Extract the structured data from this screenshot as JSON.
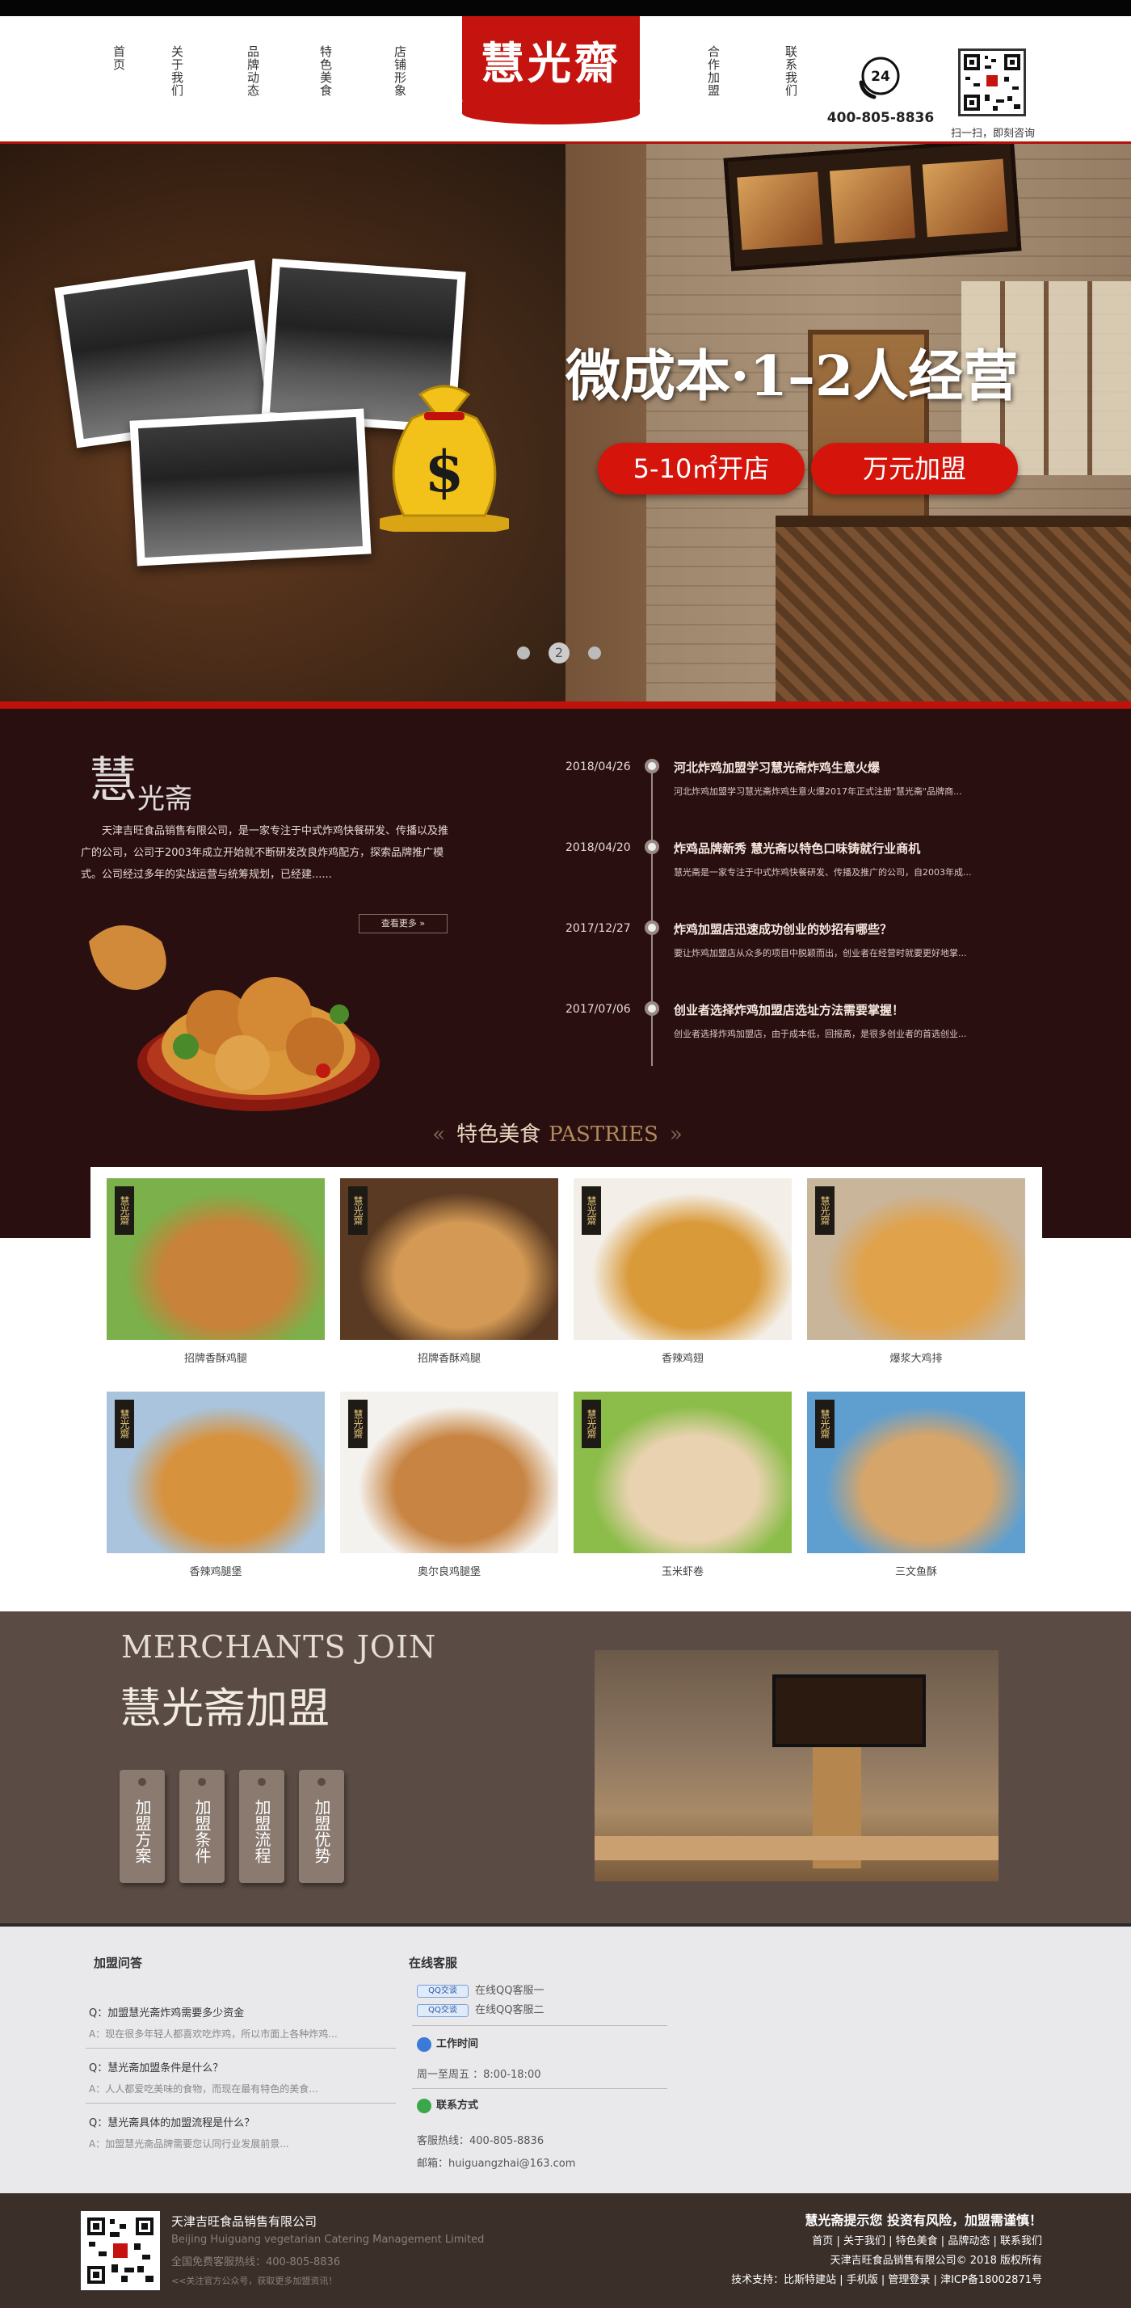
{
  "header": {
    "nav_left": [
      "首页",
      "关于我们",
      "品牌动态",
      "特色美食",
      "店铺形象"
    ],
    "nav_right": [
      "合作加盟",
      "联系我们"
    ],
    "logo": "慧光齋",
    "phone_icon_text": "24",
    "phone": "400-805-8836",
    "qr_caption": "扫一扫，即刻咨询"
  },
  "banner": {
    "title": "微成本·1–2人经营",
    "pill_left": "5-10㎡开店",
    "pill_right": "万元加盟",
    "carousel_dots": [
      "",
      "2",
      ""
    ],
    "money_symbol": "$"
  },
  "about": {
    "logo_big": "慧",
    "logo_small": "光",
    "logo_big2": "斋",
    "text": "天津吉旺食品销售有限公司，是一家专注于中式炸鸡快餐研发、传播以及推广的公司，公司于2003年成立开始就不断研发改良炸鸡配方，探索品牌推广模式。公司经过多年的实战运营与统筹规划，已经建......",
    "more": "查看更多",
    "news": [
      {
        "date": "2018/04/26",
        "title": "河北炸鸡加盟学习慧光斋炸鸡生意火爆",
        "desc": "河北炸鸡加盟学习慧光斋炸鸡生意火爆2017年正式注册\"慧光斋\"品牌商..."
      },
      {
        "date": "2018/04/20",
        "title": "炸鸡品牌新秀 慧光斋以特色口味铸就行业商机",
        "desc": "慧光斋是一家专注于中式炸鸡快餐研发、传播及推广的公司，自2003年成..."
      },
      {
        "date": "2017/12/27",
        "title": "炸鸡加盟店迅速成功创业的妙招有哪些？",
        "desc": "要让炸鸡加盟店从众多的项目中脱颖而出，创业者在经营时就要更好地掌..."
      },
      {
        "date": "2017/07/06",
        "title": "创业者选择炸鸡加盟店选址方法需要掌握！",
        "desc": "创业者选择炸鸡加盟店，由于成本低，回报高，是很多创业者的首选创业..."
      }
    ]
  },
  "pastries": {
    "title_cn": "特色美食",
    "title_en": "PASTRIES",
    "badge": "慧光齋",
    "items": [
      {
        "name": "招牌香酥鸡腿",
        "colors": [
          "#7bb04a",
          "#c8823a"
        ]
      },
      {
        "name": "招牌香酥鸡腿",
        "colors": [
          "#5a3a22",
          "#d49a55"
        ]
      },
      {
        "name": "香辣鸡翅",
        "colors": [
          "#f3efe8",
          "#d99a3a"
        ]
      },
      {
        "name": "爆浆大鸡排",
        "colors": [
          "#c9b59a",
          "#e0a24a"
        ]
      },
      {
        "name": "香辣鸡腿堡",
        "colors": [
          "#a9c4dc",
          "#d7923e"
        ]
      },
      {
        "name": "奥尔良鸡腿堡",
        "colors": [
          "#f4f2ee",
          "#c78442"
        ]
      },
      {
        "name": "玉米虾卷",
        "colors": [
          "#8cbd4a",
          "#e9d2b0"
        ]
      },
      {
        "name": "三文鱼酥",
        "colors": [
          "#5f9fd0",
          "#d6a56a"
        ]
      }
    ]
  },
  "merchants": {
    "en": "MERCHANTS JOIN",
    "cn": "慧光斋加盟",
    "tags": [
      "加盟方案",
      "加盟条件",
      "加盟流程",
      "加盟优势"
    ]
  },
  "info": {
    "faq_title": "加盟问答",
    "faq": [
      {
        "q": "Q：加盟慧光斋炸鸡需要多少资金",
        "a": "A：现在很多年轻人都喜欢吃炸鸡，所以市面上各种炸鸡..."
      },
      {
        "q": "Q：慧光斋加盟条件是什么？",
        "a": "A：人人都爱吃美味的食物，而现在最有特色的美食..."
      },
      {
        "q": "Q：慧光斋具体的加盟流程是什么？",
        "a": "A：加盟慧光斋品牌需要您认同行业发展前景..."
      }
    ],
    "service_title": "在线客服",
    "qq_badge": "QQ交谈",
    "qq": [
      "在线QQ客服一",
      "在线QQ客服二"
    ],
    "hours_title": "工作时间",
    "hours": "周一至周五 ：8:00-18:00",
    "contact_title": "联系方式",
    "hotline": "客服热线：400-805-8836",
    "email": "邮箱：huiguangzhai@163.com"
  },
  "footer": {
    "company": "天津吉旺食品销售有限公司",
    "company_en": "Beijing Huiguang vegetarian Catering Management Limited",
    "hotline": "全国免费客服热线：400-805-8836",
    "follow": "<<关注官方公众号，获取更多加盟资讯！",
    "risk": "慧光斋提示您 投资有风险，加盟需谨慎！",
    "links": [
      "首页",
      "关于我们",
      "特色美食",
      "品牌动态",
      "联系我们"
    ],
    "copyright": "天津吉旺食品销售有限公司© 2018  版权所有",
    "support": "技术支持：比斯特建站 | 手机版 | 管理登录 | 津ICP备18002871号"
  }
}
